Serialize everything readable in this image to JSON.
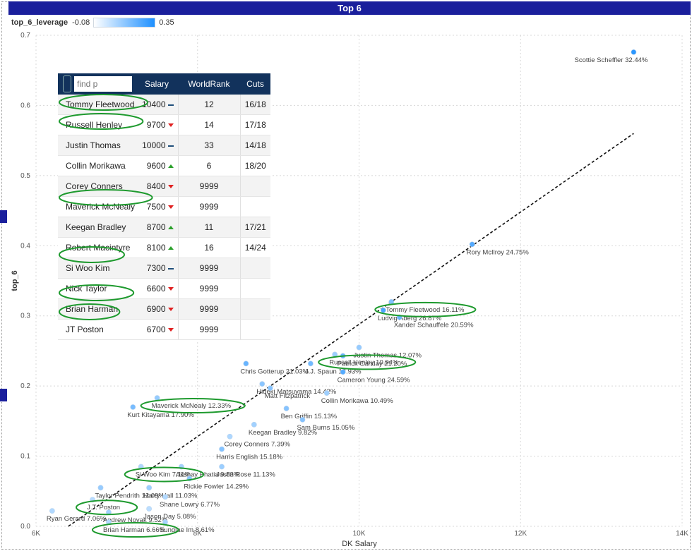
{
  "page": {
    "title": "Top 6"
  },
  "legend": {
    "title": "top_6_leverage",
    "min_label": "-0.08",
    "max_label": "0.35",
    "color_min": "#ffffff",
    "color_max": "#1e90ff"
  },
  "table": {
    "search_placeholder": "find p",
    "headers": {
      "salary": "Salary",
      "worldrank": "WorldRank",
      "cuts": "Cuts"
    },
    "rows": [
      {
        "name": "Tommy Fleetwood",
        "salary": "10400",
        "trend": "flat",
        "worldrank": "12",
        "cuts": "16/18",
        "circled": true
      },
      {
        "name": "Russell Henley",
        "salary": "9700",
        "trend": "down",
        "worldrank": "14",
        "cuts": "17/18",
        "circled": true
      },
      {
        "name": "Justin Thomas",
        "salary": "10000",
        "trend": "flat",
        "worldrank": "33",
        "cuts": "14/18",
        "circled": false
      },
      {
        "name": "Collin Morikawa",
        "salary": "9600",
        "trend": "up",
        "worldrank": "6",
        "cuts": "18/20",
        "circled": false
      },
      {
        "name": "Corey Conners",
        "salary": "8400",
        "trend": "down",
        "worldrank": "9999",
        "cuts": "",
        "circled": false
      },
      {
        "name": "Maverick McNealy",
        "salary": "7500",
        "trend": "down",
        "worldrank": "9999",
        "cuts": "",
        "circled": true
      },
      {
        "name": "Keegan Bradley",
        "salary": "8700",
        "trend": "up",
        "worldrank": "11",
        "cuts": "17/21",
        "circled": false
      },
      {
        "name": "Robert Macintyre",
        "salary": "8100",
        "trend": "up",
        "worldrank": "16",
        "cuts": "14/24",
        "circled": false
      },
      {
        "name": "Si Woo Kim",
        "salary": "7300",
        "trend": "flat",
        "worldrank": "9999",
        "cuts": "",
        "circled": true
      },
      {
        "name": "Nick Taylor",
        "salary": "6600",
        "trend": "down",
        "worldrank": "9999",
        "cuts": "",
        "circled": false
      },
      {
        "name": "Brian Harman",
        "salary": "6900",
        "trend": "down",
        "worldrank": "9999",
        "cuts": "",
        "circled": true
      },
      {
        "name": "JT Poston",
        "salary": "6700",
        "trend": "down",
        "worldrank": "9999",
        "cuts": "",
        "circled": true
      }
    ]
  },
  "chart_data": {
    "type": "scatter",
    "xlabel": "DK Salary",
    "ylabel": "top_6",
    "xlim": [
      6000,
      14000
    ],
    "ylim": [
      0,
      0.7
    ],
    "x_ticks": [
      6000,
      8000,
      10000,
      12000,
      14000
    ],
    "x_tick_labels": [
      "6K",
      "8K",
      "10K",
      "12K",
      "14K"
    ],
    "y_ticks": [
      0,
      0.1,
      0.2,
      0.3,
      0.4,
      0.5,
      0.6,
      0.7
    ],
    "y_tick_labels": [
      "0.0",
      "0.1",
      "0.2",
      "0.3",
      "0.4",
      "0.5",
      "0.6",
      "0.7"
    ],
    "grid": true,
    "trendline": {
      "style": "dashed",
      "from": [
        6400,
        0.0
      ],
      "to": [
        13400,
        0.56
      ]
    },
    "points": [
      {
        "label": "Scottie Scheffler 32.44%",
        "x": 13400,
        "y": 0.676,
        "leverage": 0.3244,
        "circled": false
      },
      {
        "label": "Rory McIlroy 24.75%",
        "x": 11400,
        "y": 0.402,
        "leverage": 0.2475,
        "circled": false
      },
      {
        "label": "Tommy Fleetwood 16.11%",
        "x": 10400,
        "y": 0.32,
        "leverage": 0.1611,
        "circled": true
      },
      {
        "label": "Ludvig Aberg 26.87%",
        "x": 10300,
        "y": 0.308,
        "leverage": 0.2687,
        "circled": false
      },
      {
        "label": "Xander Schauffele 20.59%",
        "x": 10500,
        "y": 0.298,
        "leverage": 0.2059,
        "circled": false
      },
      {
        "label": "Justin Thomas 12.07%",
        "x": 10000,
        "y": 0.255,
        "leverage": 0.1207,
        "circled": false
      },
      {
        "label": "Russell Henley 10.94%",
        "x": 9700,
        "y": 0.245,
        "leverage": 0.1094,
        "circled": true
      },
      {
        "label": "Patrick Cantlay 21.20%",
        "x": 9800,
        "y": 0.243,
        "leverage": 0.212,
        "circled": false
      },
      {
        "label": "J.J. Spaun 18.93%",
        "x": 9400,
        "y": 0.232,
        "leverage": 0.1893,
        "circled": false
      },
      {
        "label": "Chris Gotterup 21.03%",
        "x": 8600,
        "y": 0.232,
        "leverage": 0.2103,
        "circled": false
      },
      {
        "label": "Cameron Young 24.59%",
        "x": 9800,
        "y": 0.22,
        "leverage": 0.2459,
        "circled": false
      },
      {
        "label": "Hideki Matsuyama 14.42%",
        "x": 8800,
        "y": 0.203,
        "leverage": 0.1442,
        "circled": false
      },
      {
        "label": "Matt Fitzpatrick",
        "x": 8900,
        "y": 0.197,
        "leverage": 0.15,
        "circled": false
      },
      {
        "label": "Collin Morikawa 10.49%",
        "x": 9600,
        "y": 0.19,
        "leverage": 0.1049,
        "circled": false
      },
      {
        "label": "Maverick McNealy 12.33%",
        "x": 7500,
        "y": 0.183,
        "leverage": 0.1233,
        "circled": true
      },
      {
        "label": "Kurt Kitayama 17.90%",
        "x": 7200,
        "y": 0.17,
        "leverage": 0.179,
        "circled": false
      },
      {
        "label": "Ben Griffin 15.13%",
        "x": 9100,
        "y": 0.168,
        "leverage": 0.1513,
        "circled": false
      },
      {
        "label": "Sam Burns 15.05%",
        "x": 9300,
        "y": 0.152,
        "leverage": 0.1505,
        "circled": false
      },
      {
        "label": "Keegan Bradley 9.82%",
        "x": 8700,
        "y": 0.145,
        "leverage": 0.0982,
        "circled": false
      },
      {
        "label": "Corey Conners 7.39%",
        "x": 8400,
        "y": 0.128,
        "leverage": 0.0739,
        "circled": false
      },
      {
        "label": "Harris English 15.18%",
        "x": 8300,
        "y": 0.11,
        "leverage": 0.1518,
        "circled": false
      },
      {
        "label": "Si Woo Kim 7.11%",
        "x": 7300,
        "y": 0.085,
        "leverage": 0.0711,
        "circled": true
      },
      {
        "label": "Akshay Bhatia 9.83%",
        "x": 7800,
        "y": 0.085,
        "leverage": 0.0983,
        "circled": false
      },
      {
        "label": "Justin Rose 11.13%",
        "x": 8300,
        "y": 0.085,
        "leverage": 0.1113,
        "circled": false
      },
      {
        "label": "Rickie Fowler 14.29%",
        "x": 7900,
        "y": 0.068,
        "leverage": 0.1429,
        "circled": false
      },
      {
        "label": "Taylor Pendrith 12.09%",
        "x": 6800,
        "y": 0.055,
        "leverage": 0.1209,
        "circled": false
      },
      {
        "label": "Harry Hall 11.03%",
        "x": 7400,
        "y": 0.055,
        "leverage": 0.1103,
        "circled": false
      },
      {
        "label": "Shane Lowry 6.77%",
        "x": 7600,
        "y": 0.042,
        "leverage": 0.0677,
        "circled": false
      },
      {
        "label": "J.T. Poston",
        "x": 6700,
        "y": 0.038,
        "leverage": 0.06,
        "circled": true
      },
      {
        "label": "Jason Day 5.08%",
        "x": 7400,
        "y": 0.025,
        "leverage": 0.0508,
        "circled": false
      },
      {
        "label": "Andrew Novak 9.52%",
        "x": 6900,
        "y": 0.02,
        "leverage": 0.0952,
        "circled": false
      },
      {
        "label": "Ryan Gerard 7.06%",
        "x": 6200,
        "y": 0.022,
        "leverage": 0.0706,
        "circled": false
      },
      {
        "label": "Brian Harman 6.66%",
        "x": 6900,
        "y": 0.006,
        "leverage": 0.0666,
        "circled": true
      },
      {
        "label": "Sungjae Im 8.61%",
        "x": 7600,
        "y": 0.006,
        "leverage": 0.0861,
        "circled": false
      }
    ]
  }
}
